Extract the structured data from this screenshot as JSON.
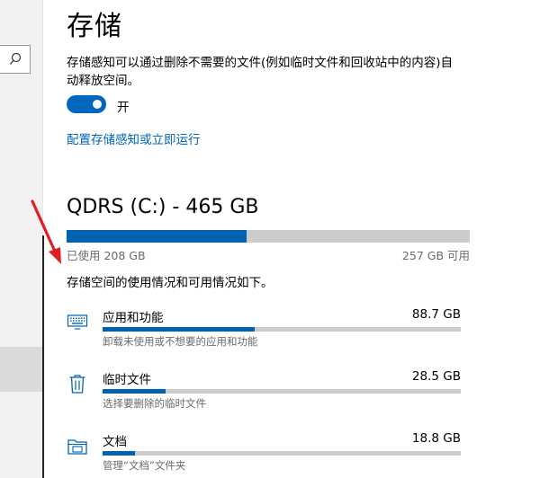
{
  "page": {
    "title": "存储",
    "description": "存储感知可以通过删除不需要的文件(例如临时文件和回收站中的内容)自动释放空间。",
    "toggle": {
      "state_label": "开",
      "on": true
    },
    "configure_link": "配置存储感知或立即运行"
  },
  "drive": {
    "title": "QDRS (C:) - 465 GB",
    "used_label": "已使用 208 GB",
    "free_label": "257 GB 可用",
    "used_fraction": 0.447
  },
  "usage_intro": "存储空间的使用情况和可用情况如下。",
  "categories": [
    {
      "name": "应用和功能",
      "size": "88.7 GB",
      "subtitle": "卸载未使用或不想要的应用和功能",
      "fraction": 0.425,
      "icon": "keyboard-icon"
    },
    {
      "name": "临时文件",
      "size": "28.5 GB",
      "subtitle": "选择要删除的临时文件",
      "fraction": 0.175,
      "icon": "trash-icon"
    },
    {
      "name": "文档",
      "size": "18.8 GB",
      "subtitle": "管理“文档”文件夹",
      "fraction": 0.09,
      "icon": "folder-icon"
    }
  ],
  "colors": {
    "accent": "#0063b1",
    "link": "#0066b4",
    "track": "#cccccc",
    "annotation": "#e02020"
  }
}
